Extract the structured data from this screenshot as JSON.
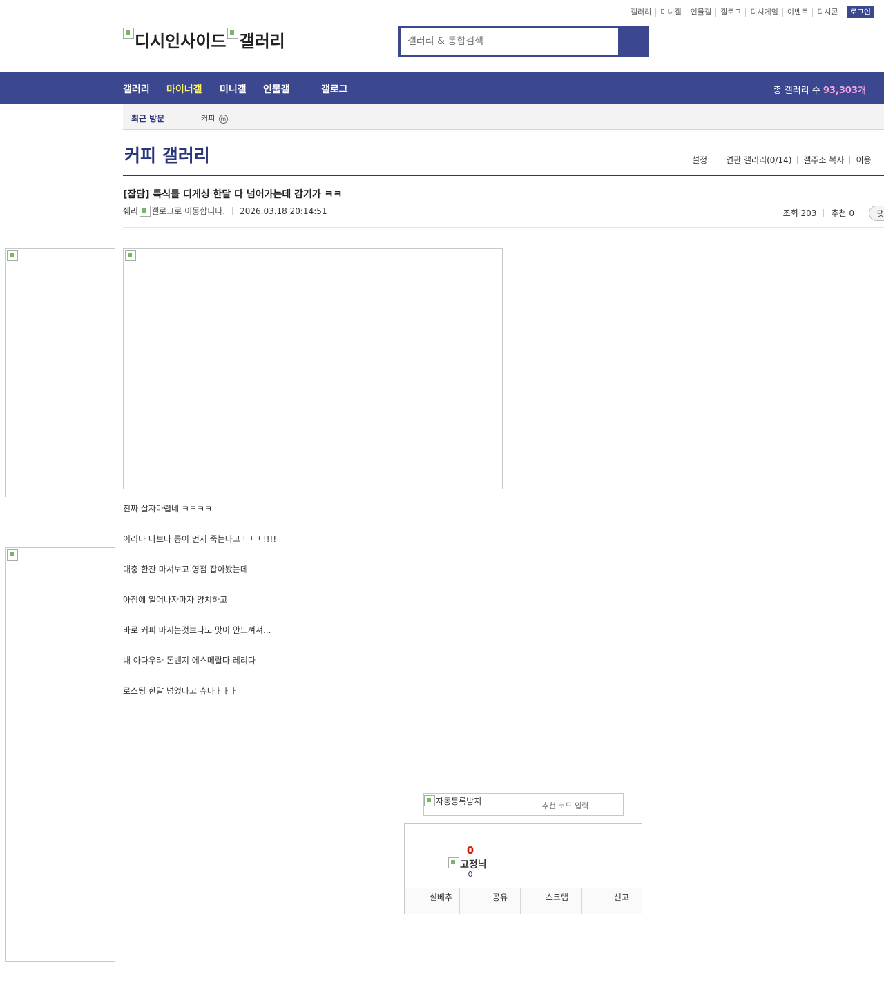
{
  "top_links": [
    "갤러리",
    "미니갤",
    "인물갤",
    "갤로그",
    "디시게임",
    "이벤트",
    "디시콘"
  ],
  "login_label": "로그인",
  "logo": {
    "part1_alt": "디시인사이드",
    "part2_alt": "갤러리"
  },
  "search": {
    "placeholder": "갤러리 & 통합검색"
  },
  "gnb": {
    "items": [
      "갤러리",
      "마이너갤",
      "미니갤",
      "인물갤",
      "갤로그"
    ],
    "active": "마이너갤",
    "total_label": "총 갤러리 수",
    "total_value": "93,303개"
  },
  "recent": {
    "label": "최근 방문",
    "item": "커피",
    "badge": "m"
  },
  "gallery": {
    "title": "커피 갤러리",
    "options": [
      "설정",
      "연관 갤러리(0/14)",
      "갤주소 복사",
      "이용"
    ]
  },
  "post": {
    "title": "[잡담] 특식들 디게싱 한달 다 넘어가는데 감기가 ㅋㅋ",
    "writer": "쉐리",
    "gallog_alt": "갤로그로 이동합니다.",
    "date": "2026.03.18 20:14:51",
    "views_label": "조회 203",
    "recommend_label": "추천 0",
    "comment_btn": "댓",
    "body": [
      "진짜 살자마렵네 ㅋㅋㅋㅋ",
      "이러다 나보다 콩이 먼저 죽는다고ㅗㅗㅗ!!!!",
      "대충 한잔 마셔보고 영점 잡아봤는데",
      "아침에 일어나자마자 양치하고",
      "바로 커피 마시는것보다도 맛이 안느껴져...",
      "내 아다우라 돈벤지 에스메랄다 레리다",
      "로스팅 한달 넘었다고 슈바ㅏㅏㅏ"
    ]
  },
  "captcha": {
    "img_alt": "자동등록방지",
    "placeholder": "추천 코드 입력"
  },
  "recommend": {
    "up_count": "0",
    "fix_nick_alt": "고정닉",
    "fix_count": "0",
    "buttons": [
      "실베추",
      "공유",
      "스크랩",
      "신고"
    ]
  }
}
